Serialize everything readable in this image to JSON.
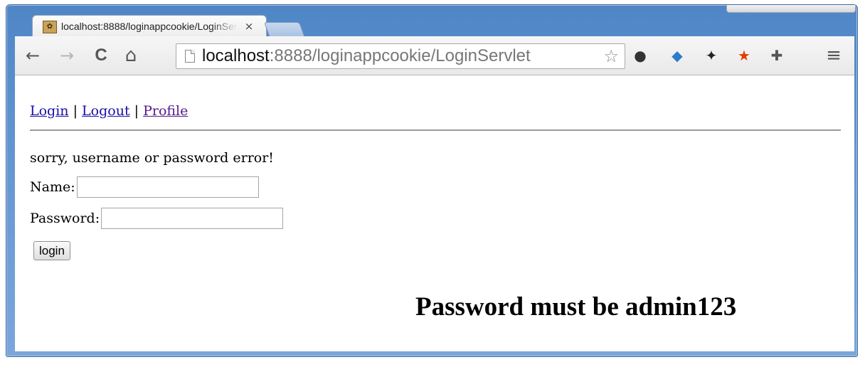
{
  "browser": {
    "tab": {
      "title": "localhost:8888/loginappcookie/LoginServlet",
      "close_glyph": "×",
      "favicon": "page-favicon"
    },
    "toolbar": {
      "back_glyph": "←",
      "forward_glyph": "→",
      "reload_glyph": "C",
      "home_glyph": "⌂",
      "url_host": "localhost",
      "url_rest": ":8888/loginappcookie/LoginServlet",
      "star_glyph": "☆",
      "menu_glyph": "≡"
    },
    "extensions": [
      {
        "name": "ext-1-icon",
        "glyph": "●",
        "color": "#333"
      },
      {
        "name": "ext-2-icon",
        "glyph": "◆",
        "color": "#2b7cc9"
      },
      {
        "name": "ext-3-icon",
        "glyph": "✦",
        "color": "#222"
      },
      {
        "name": "ext-4-icon",
        "glyph": "★",
        "color": "#e23b00"
      },
      {
        "name": "ext-5-icon",
        "glyph": "✚",
        "color": "#555"
      }
    ]
  },
  "page": {
    "nav": {
      "login": "Login",
      "logout": "Logout",
      "profile": "Profile",
      "separator": "|"
    },
    "error_message": "sorry, username or password error!",
    "form": {
      "name_label": "Name:",
      "name_value": "",
      "password_label": "Password:",
      "password_value": "",
      "submit_label": "login"
    },
    "annotation": "Password must be admin123"
  },
  "colors": {
    "link": "#1a0dab",
    "visited_link": "#551a8b",
    "frame": "#4f86c6"
  }
}
